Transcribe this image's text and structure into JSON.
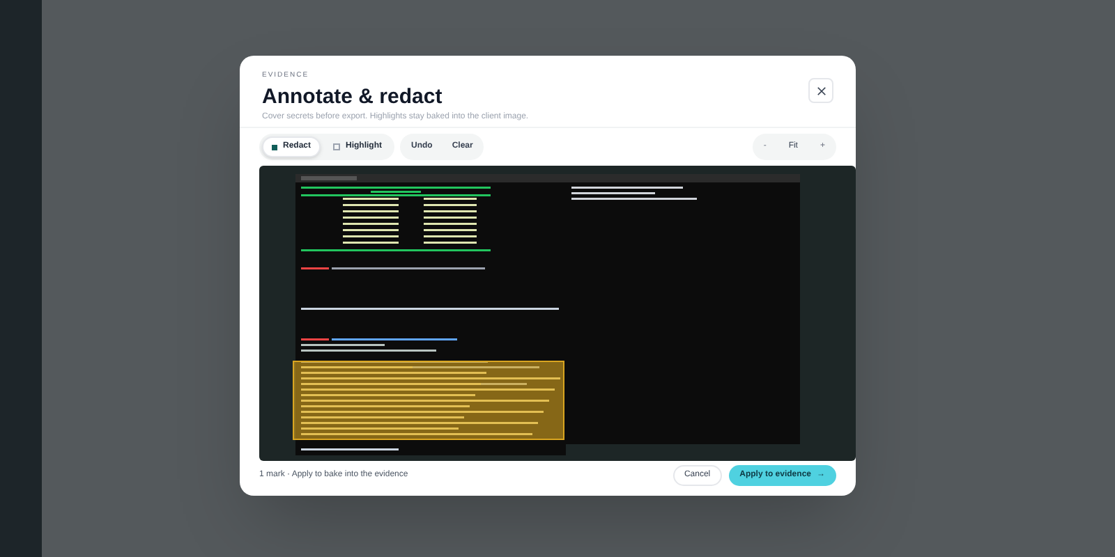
{
  "dialog": {
    "eyebrow": "EVIDENCE",
    "title": "Annotate & redact",
    "subtitle": "Cover secrets before export. Highlights stay baked into the client image.",
    "tools": [
      {
        "kind": "redact",
        "label": "Redact",
        "selected": true
      },
      {
        "kind": "highlight",
        "label": "Highlight",
        "selected": false
      }
    ],
    "history": [
      "Undo",
      "Clear"
    ],
    "zoom": {
      "out": "-",
      "label": "Fit",
      "in": "+"
    },
    "marks": [
      {
        "kind": "highlight",
        "color": "#d9a520"
      }
    ],
    "footer_note": "1 mark · Apply to bake into the evidence",
    "cancel": "Cancel",
    "apply": "Apply to evidence",
    "apply_arrow": "→"
  }
}
